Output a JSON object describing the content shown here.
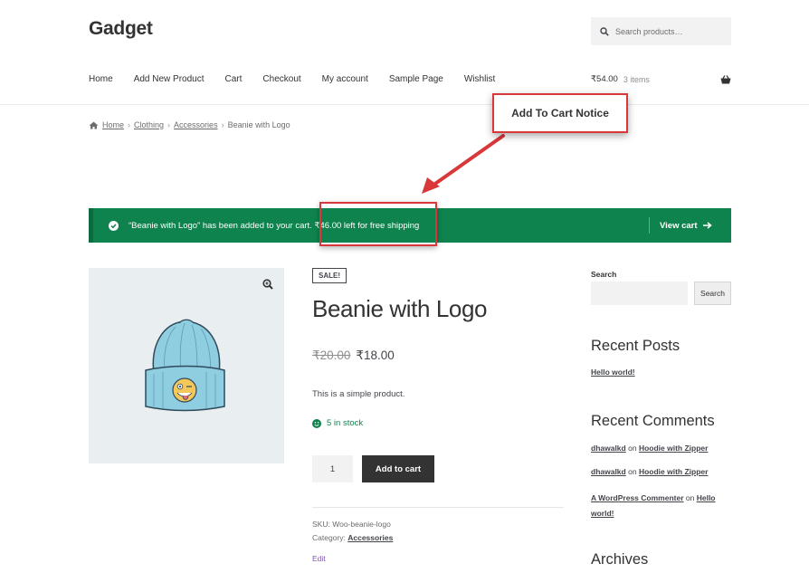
{
  "site": {
    "title": "Gadget"
  },
  "search": {
    "placeholder": "Search products…"
  },
  "nav": [
    "Home",
    "Add New Product",
    "Cart",
    "Checkout",
    "My account",
    "Sample Page",
    "Wishlist"
  ],
  "cart": {
    "total": "₹54.00",
    "items": "3 items"
  },
  "breadcrumb": {
    "home": "Home",
    "category": "Clothing",
    "subcategory": "Accessories",
    "current": "Beanie with Logo",
    "separator": "›"
  },
  "notice": {
    "message": "“Beanie with Logo” has been added to your cart. ₹46.00 left for free shipping",
    "view_cart": "View cart",
    "color": "#0f834d"
  },
  "annotation": {
    "label": "Add To Cart Notice",
    "color": "#d9383a"
  },
  "product": {
    "badge": "SALE!",
    "title": "Beanie with Logo",
    "old_price": "₹20.00",
    "price": "₹18.00",
    "description": "This is a simple product.",
    "stock": "5 in stock",
    "quantity": "1",
    "add_to_cart": "Add to cart",
    "sku_label": "SKU:",
    "sku": "Woo-beanie-logo",
    "category_label": "Category:",
    "category": "Accessories",
    "edit": "Edit"
  },
  "sidebar": {
    "search_label": "Search",
    "search_button": "Search",
    "recent_posts_title": "Recent Posts",
    "recent_post": "Hello world!",
    "recent_comments_title": "Recent Comments",
    "comments": [
      {
        "author": "dhawalkd",
        "on": "on",
        "post": "Hoodie with Zipper"
      },
      {
        "author": "dhawalkd",
        "on": "on",
        "post": "Hoodie with Zipper"
      },
      {
        "author": "A WordPress Commenter",
        "on": "on",
        "post": "Hello world!"
      }
    ],
    "archives_title": "Archives"
  }
}
